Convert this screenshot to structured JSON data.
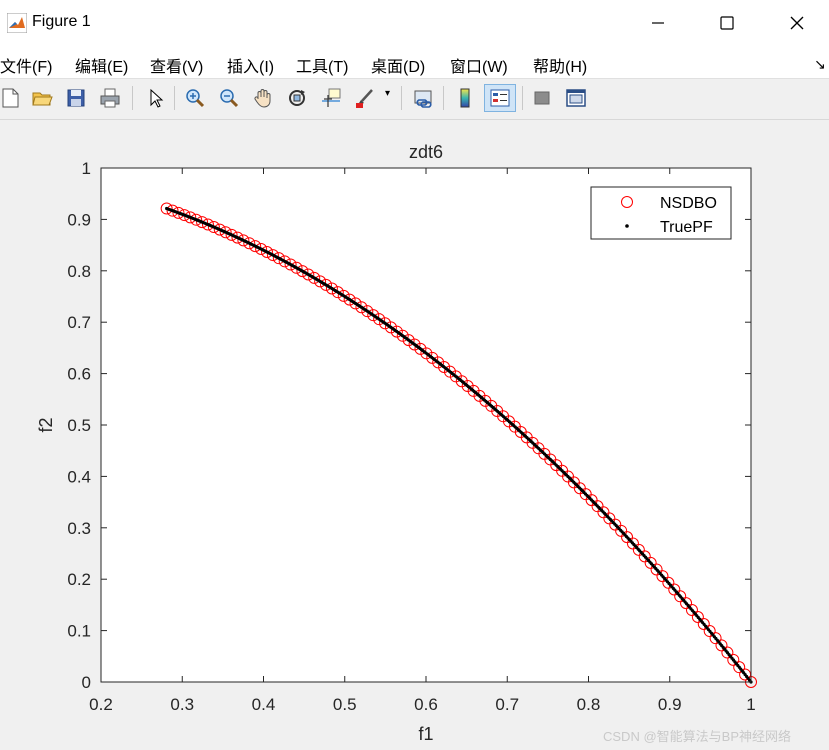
{
  "window": {
    "title": "Figure 1",
    "minimize_icon": "minimize-icon",
    "maximize_icon": "maximize-icon",
    "close_icon": "close-icon"
  },
  "menu": {
    "items": [
      "文件(F)",
      "编辑(E)",
      "查看(V)",
      "插入(I)",
      "工具(T)",
      "桌面(D)",
      "窗口(W)",
      "帮助(H)"
    ],
    "dock_glyph": "↘"
  },
  "toolbar": {
    "icons": [
      "new-figure-icon",
      "open-icon",
      "save-icon",
      "print-icon",
      "select-arrow-icon",
      "zoom-in-icon",
      "zoom-out-icon",
      "pan-hand-icon",
      "rotate-3d-icon",
      "data-cursor-icon",
      "brush-icon",
      "brush-dropdown-icon",
      "link-plot-icon",
      "colorbar-icon",
      "legend-icon",
      "hide-plot-tools-icon",
      "show-plot-tools-icon"
    ]
  },
  "colors": {
    "nsdbo": "#ff0000",
    "truepf": "#000000",
    "axes_bg": "#ffffff",
    "figure_bg": "#f0f0f0"
  },
  "chart_data": {
    "type": "scatter",
    "title": "zdt6",
    "xlabel": "f1",
    "ylabel": "f2",
    "xlim": [
      0.2,
      1
    ],
    "ylim": [
      0,
      1
    ],
    "xticks": [
      "0.2",
      "0.3",
      "0.4",
      "0.5",
      "0.6",
      "0.7",
      "0.8",
      "0.9",
      "1"
    ],
    "yticks": [
      "0",
      "0.1",
      "0.2",
      "0.3",
      "0.4",
      "0.5",
      "0.6",
      "0.7",
      "0.8",
      "0.9",
      "1"
    ],
    "legend_position": "top-right",
    "series": [
      {
        "name": "NSDBO",
        "marker": "open-circle",
        "color": "#ff0000",
        "x_range": [
          0.2808,
          1.0
        ],
        "relation": "f2 = 1 - f1^2",
        "count": 100
      },
      {
        "name": "TruePF",
        "marker": "dot",
        "color": "#000000",
        "x_range": [
          0.2808,
          1.0
        ],
        "relation": "f2 = 1 - f1^2",
        "count": 400
      }
    ]
  },
  "watermark": "CSDN @智能算法与BP神经网络"
}
